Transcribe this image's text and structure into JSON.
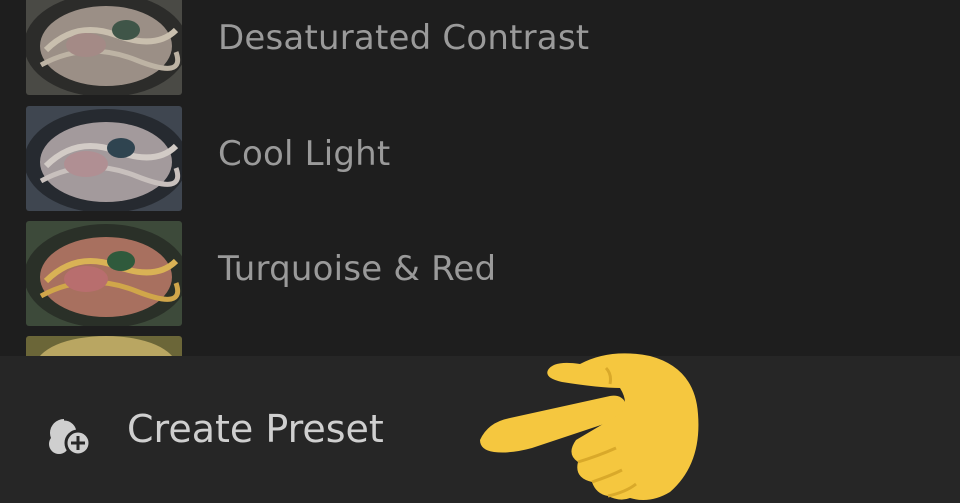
{
  "presets": [
    {
      "label": "Desaturated Contrast",
      "thumb_tone": "desaturated"
    },
    {
      "label": "Cool Light",
      "thumb_tone": "cool"
    },
    {
      "label": "Turquoise & Red",
      "thumb_tone": "warm"
    },
    {
      "label": "",
      "thumb_tone": "yellow"
    }
  ],
  "bottom_bar": {
    "create_label": "Create Preset",
    "create_icon": "presets-add-icon"
  },
  "overlay": {
    "pointer_icon": "pointing-hand-emoji",
    "pointer_color": "#f5c73f"
  },
  "colors": {
    "background": "#1e1e1e",
    "bottom_bar": "#262626",
    "label_text": "#9a9a9a",
    "create_text": "#cfcfcf"
  }
}
